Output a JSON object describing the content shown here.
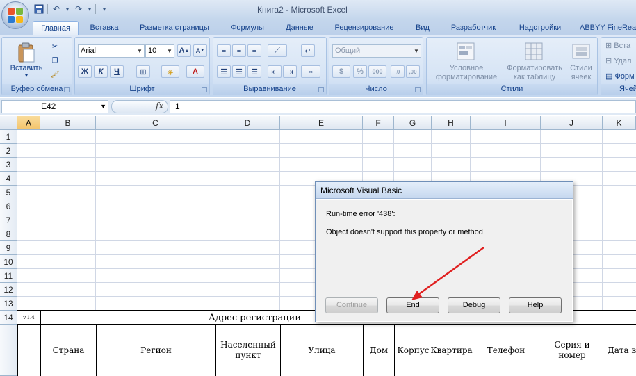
{
  "window": {
    "title": "Книга2 - Microsoft Excel"
  },
  "quick_access": {
    "icons": [
      "save-icon",
      "undo-icon",
      "redo-icon",
      "customize-icon"
    ]
  },
  "tabs": [
    "Главная",
    "Вставка",
    "Разметка страницы",
    "Формулы",
    "Данные",
    "Рецензирование",
    "Вид",
    "Разработчик",
    "Надстройки",
    "ABBYY FineReader"
  ],
  "ribbon": {
    "clipboard": {
      "paste_label": "Вставить",
      "group_label": "Буфер обмена"
    },
    "font": {
      "font_name": "Arial",
      "font_size": "10",
      "group_label": "Шрифт",
      "bold": "Ж",
      "italic": "К",
      "underline": "Ч"
    },
    "alignment": {
      "group_label": "Выравнивание"
    },
    "number": {
      "format": "Общий",
      "percent": "%",
      "thousands": "000",
      "group_label": "Число"
    },
    "styles": {
      "cond_format": "Условное форматирование",
      "format_table": "Форматировать как таблицу",
      "cell_styles": "Стили ячеек",
      "group_label": "Стили"
    },
    "cells": {
      "insert": "Вста",
      "delete": "Удал",
      "format": "Форм",
      "group_label": "Ячей"
    }
  },
  "formula_bar": {
    "name_box": "E42",
    "fx": "fx",
    "value": "1"
  },
  "sheet": {
    "columns": [
      "A",
      "B",
      "C",
      "D",
      "E",
      "F",
      "G",
      "H",
      "I",
      "J",
      "K"
    ],
    "selected_column": "A",
    "rows": [
      "1",
      "2",
      "3",
      "4",
      "5",
      "6",
      "7",
      "8",
      "9",
      "10",
      "11",
      "12",
      "13",
      "14",
      ""
    ],
    "cells": {
      "a14": "v.1.4",
      "address_header": "Адрес регистрации",
      "b15": "Страна",
      "c15": "Регион",
      "d15": "Населенный пункт",
      "e15": "Улица",
      "f15": "Дом",
      "g15": "Корпус",
      "h15": "Квартира",
      "i15": "Телефон",
      "j15": "Серия и номер",
      "k15": "Дата вы"
    }
  },
  "dialog": {
    "title": "Microsoft Visual Basic",
    "error_line": "Run-time error '438':",
    "message": "Object doesn't support this property or method",
    "buttons": {
      "continue": "Continue",
      "end": "End",
      "debug": "Debug",
      "help": "Help"
    }
  },
  "colors": {
    "annotation_arrow": "#e02020",
    "selected_header": "#f3c46b"
  }
}
